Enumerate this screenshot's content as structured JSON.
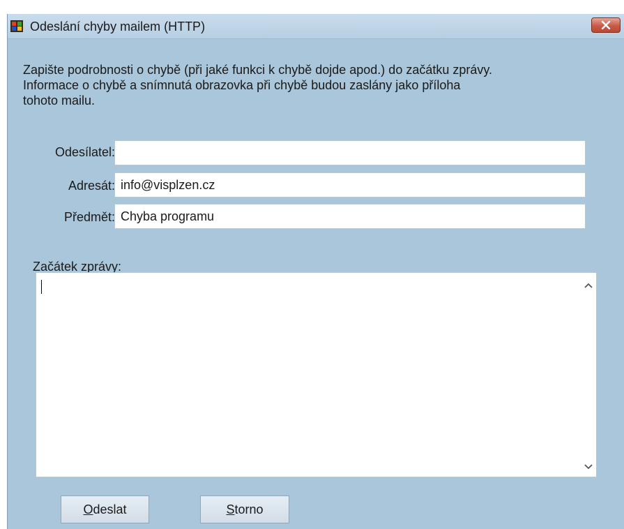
{
  "window": {
    "title": "Odeslání chyby mailem (HTTP)",
    "close_icon": "close-x-icon",
    "app_icon": "app-windows-icon"
  },
  "description": {
    "line1": "Zapište podrobnosti o chybě (při jaké funkci k chybě dojde apod.) do začátku zprávy.",
    "line2": "Informace o chybě a snímnutá obrazovka při chybě budou zaslány jako příloha",
    "line3": "tohoto mailu."
  },
  "form": {
    "sender_label": "Odesílatel:",
    "sender_value": "",
    "recipient_label": "Adresát:",
    "recipient_value": "info@visplzen.cz",
    "subject_label": "Předmět:",
    "subject_value": "Chyba programu",
    "message_label": "Začátek zprávy:",
    "message_value": ""
  },
  "buttons": {
    "send_mnemonic": "O",
    "send_rest": "deslat",
    "cancel_mnemonic": "S",
    "cancel_rest": "torno"
  },
  "colors": {
    "dialog_bg": "#a9c6da",
    "close_button": "#c75b48"
  }
}
